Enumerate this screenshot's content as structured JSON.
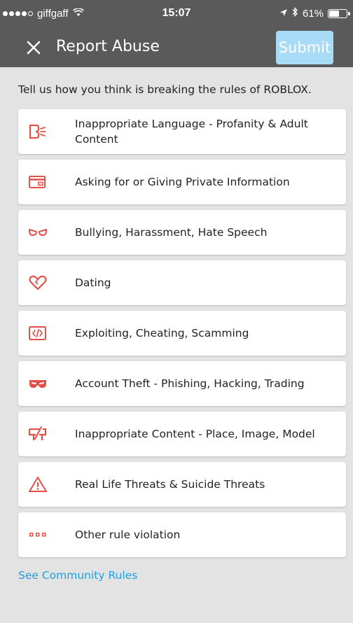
{
  "status": {
    "carrier": "giffgaff",
    "time": "15:07",
    "battery_text": "61%",
    "battery_level": 0.61
  },
  "nav": {
    "title": "Report Abuse",
    "submit_label": "Submit"
  },
  "intro": "Tell us how you think is breaking the rules of ROBLOX.",
  "categories": [
    {
      "label": "Inappropriate Language - Profanity & Adult Content",
      "icon": "speech-icon"
    },
    {
      "label": "Asking for or Giving Private Information",
      "icon": "card-icon"
    },
    {
      "label": "Bullying, Harassment, Hate Speech",
      "icon": "mask-icon"
    },
    {
      "label": "Dating",
      "icon": "heart-icon"
    },
    {
      "label": "Exploiting, Cheating, Scamming",
      "icon": "code-icon"
    },
    {
      "label": "Account Theft - Phishing, Hacking, Trading",
      "icon": "bandit-icon"
    },
    {
      "label": "Inappropriate Content - Place, Image, Model",
      "icon": "broken-sign-icon"
    },
    {
      "label": "Real Life Threats & Suicide Threats",
      "icon": "warning-icon"
    },
    {
      "label": "Other rule violation",
      "icon": "dots-icon"
    }
  ],
  "footer": {
    "community_rules_link": "See Community Rules"
  },
  "colors": {
    "accent_red": "#e2504b",
    "link_blue": "#1e9fe3",
    "header_gray": "#5a5a5a",
    "submit_disabled": "#a8dbf5",
    "background": "#e3e3e3"
  }
}
